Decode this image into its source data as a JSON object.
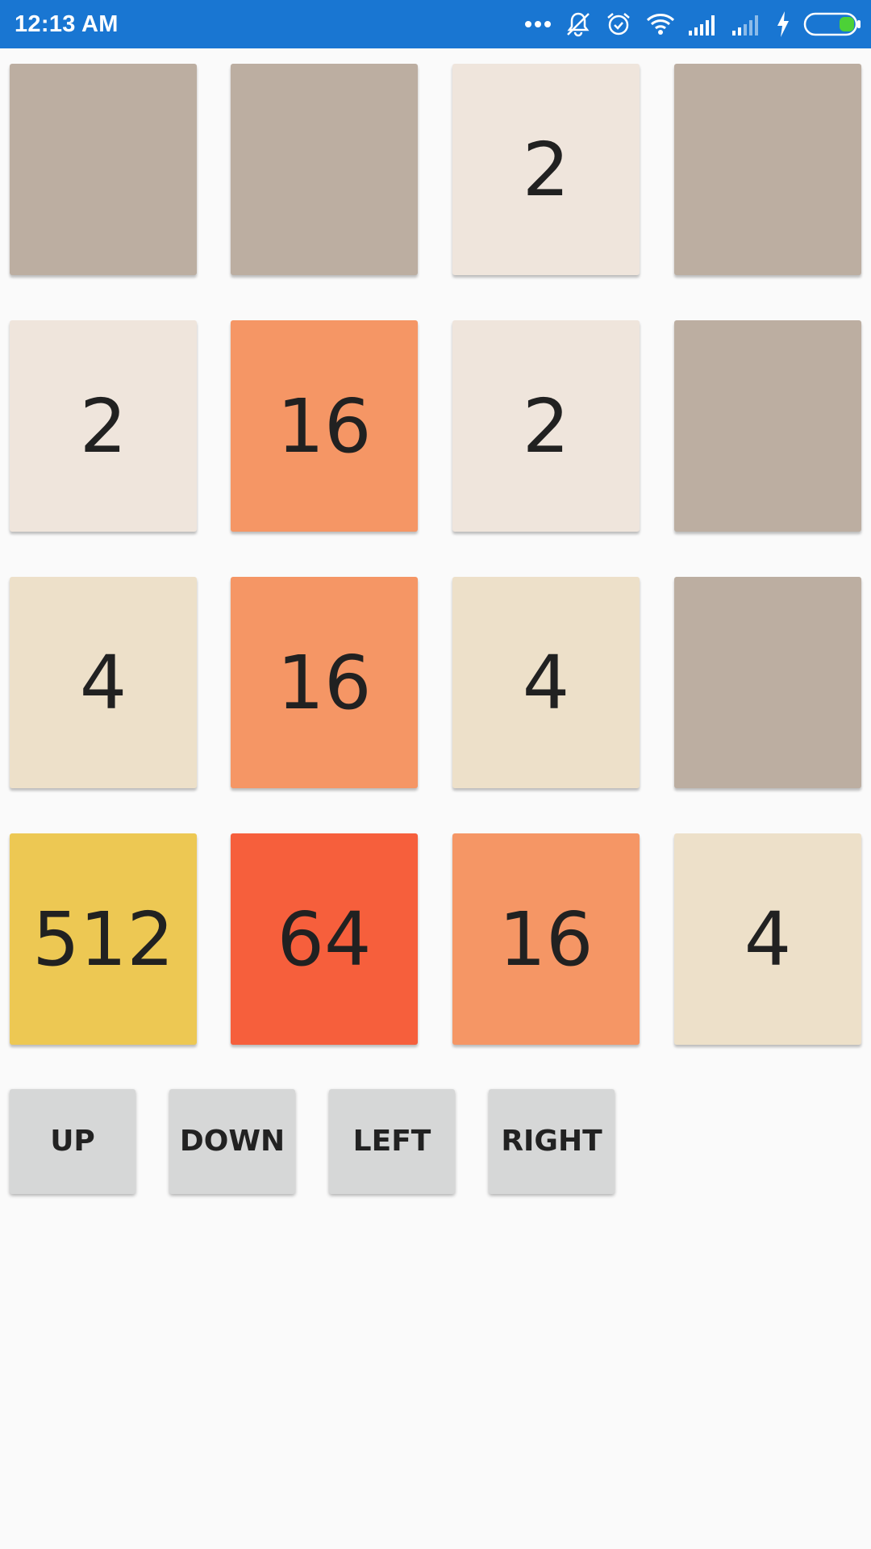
{
  "status_bar": {
    "time": "12:13 AM",
    "icons": [
      "more-dots-icon",
      "notifications-off-icon",
      "alarm-icon",
      "wifi-icon",
      "signal-icon",
      "signal-weak-icon",
      "charging-icon",
      "battery-icon"
    ]
  },
  "board": {
    "rows": [
      [
        "",
        "",
        "2",
        ""
      ],
      [
        "2",
        "16",
        "2",
        ""
      ],
      [
        "4",
        "16",
        "4",
        ""
      ],
      [
        "512",
        "64",
        "16",
        "4"
      ]
    ]
  },
  "tile_colors": {
    "empty": "#bcaea1",
    "2": "#efe5dc",
    "4": "#ede0c9",
    "16": "#f59665",
    "64": "#f65f3c",
    "512": "#edc853"
  },
  "controls": {
    "up_label": "UP",
    "down_label": "DOWN",
    "left_label": "LEFT",
    "right_label": "RIGHT"
  }
}
